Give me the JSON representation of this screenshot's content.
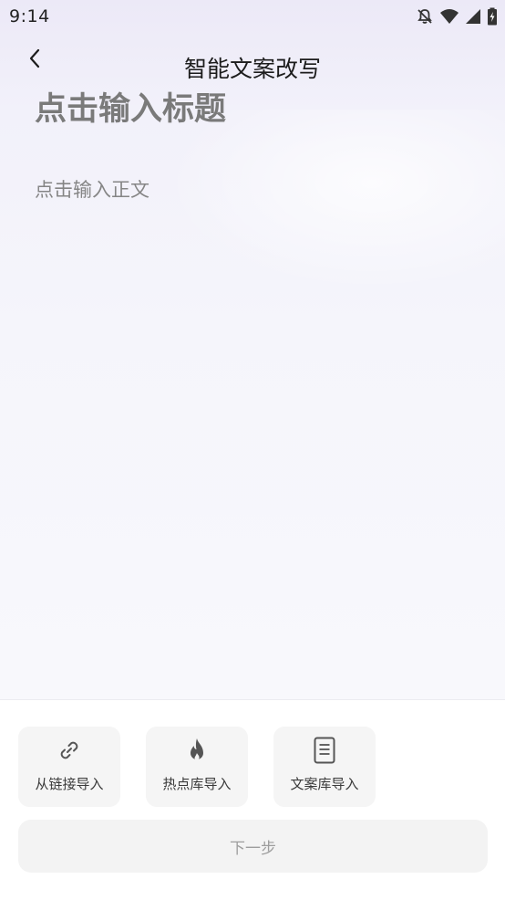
{
  "status_bar": {
    "time": "9:14",
    "icons": [
      "notifications-off-icon",
      "wifi-icon",
      "cellular-signal-icon",
      "battery-charging-icon"
    ]
  },
  "header": {
    "back_icon": "chevron-left-icon",
    "title": "智能文案改写"
  },
  "editor": {
    "title_placeholder": "点击输入标题",
    "body_placeholder": "点击输入正文"
  },
  "import_options": [
    {
      "label": "从链接导入",
      "icon": "link-icon"
    },
    {
      "label": "热点库导入",
      "icon": "flame-icon"
    },
    {
      "label": "文案库导入",
      "icon": "document-icon"
    }
  ],
  "next_button": {
    "label": "下一步"
  },
  "colors": {
    "background_top": "#ece9f7",
    "background_bottom": "#f8f8fc",
    "placeholder_text": "#7a7a7a",
    "option_bg": "#f5f5f5",
    "button_disabled_bg": "#f3f3f3",
    "button_disabled_text": "#9d9d9d"
  }
}
